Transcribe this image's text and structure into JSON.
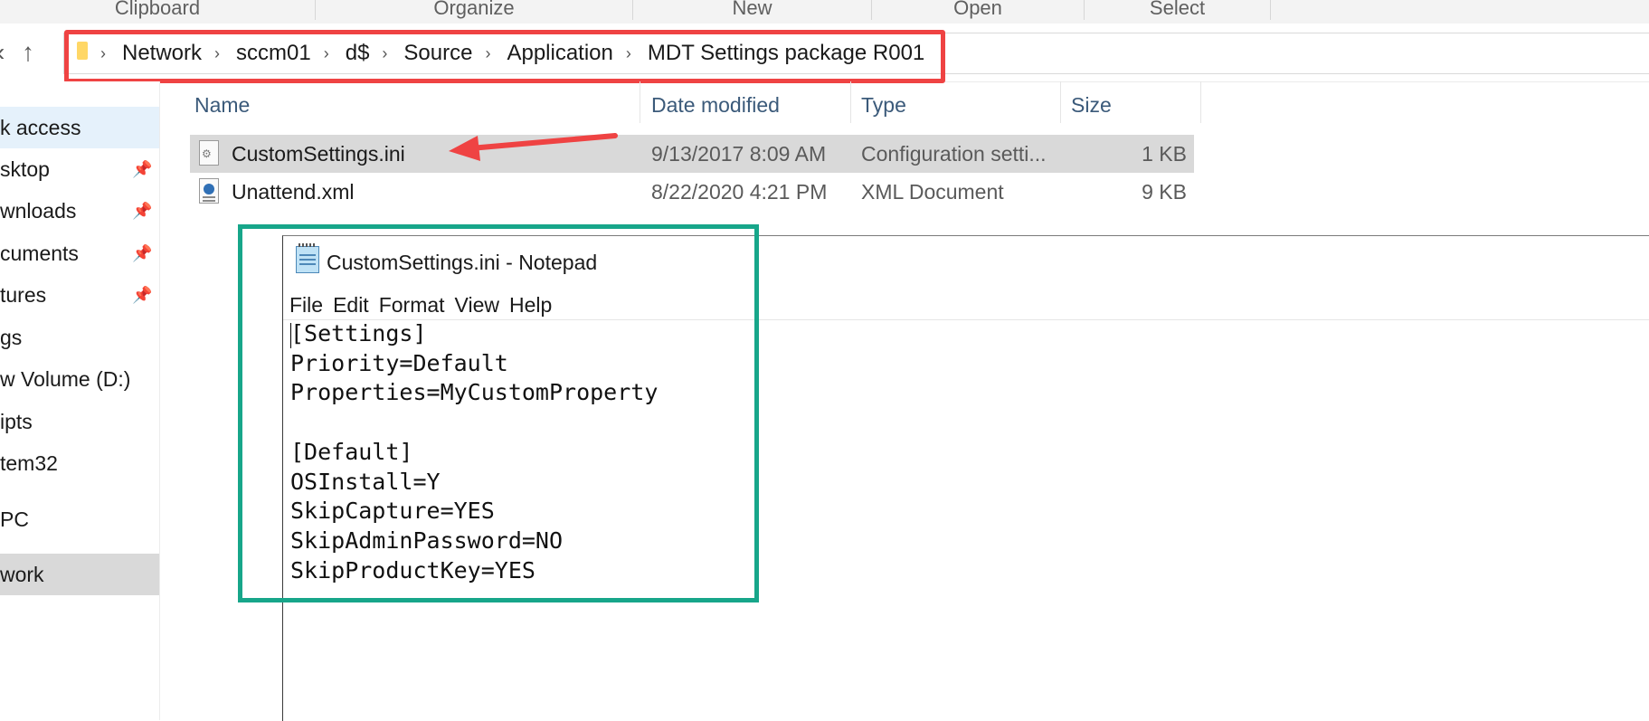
{
  "ribbon": {
    "groups": [
      "Clipboard",
      "Organize",
      "New",
      "Open",
      "Select"
    ]
  },
  "nav": {
    "back_icon": "chevron-left-icon",
    "up_icon": "arrow-up-icon",
    "breadcrumbs": [
      "Network",
      "sccm01",
      "d$",
      "Source",
      "Application",
      "MDT Settings package R001"
    ]
  },
  "sidebar": {
    "items": [
      {
        "label": "k access",
        "pinned": false
      },
      {
        "label": "sktop",
        "pinned": true
      },
      {
        "label": "wnloads",
        "pinned": true
      },
      {
        "label": "cuments",
        "pinned": true
      },
      {
        "label": "tures",
        "pinned": true
      },
      {
        "label": "gs",
        "pinned": false
      },
      {
        "label": "w Volume (D:)",
        "pinned": false
      },
      {
        "label": "ipts",
        "pinned": false
      },
      {
        "label": "tem32",
        "pinned": false
      },
      {
        "label": "PC",
        "pinned": false
      },
      {
        "label": "work",
        "pinned": false
      }
    ]
  },
  "file_list": {
    "columns": [
      "Name",
      "Date modified",
      "Type",
      "Size"
    ],
    "rows": [
      {
        "name": "CustomSettings.ini",
        "date": "9/13/2017 8:09 AM",
        "type": "Configuration setti...",
        "size": "1 KB",
        "icon": "ini-file-icon"
      },
      {
        "name": "Unattend.xml",
        "date": "8/22/2020 4:21 PM",
        "type": "XML Document",
        "size": "9 KB",
        "icon": "xml-file-icon"
      }
    ]
  },
  "notepad": {
    "title": "CustomSettings.ini - Notepad",
    "menu": [
      "File",
      "Edit",
      "Format",
      "View",
      "Help"
    ],
    "content": "[Settings]\nPriority=Default\nProperties=MyCustomProperty\n\n[Default]\nOSInstall=Y\nSkipCapture=YES\nSkipAdminPassword=NO\nSkipProductKey=YES"
  },
  "annotations": {
    "red_color": "#ef4343",
    "green_color": "#17a68a"
  }
}
